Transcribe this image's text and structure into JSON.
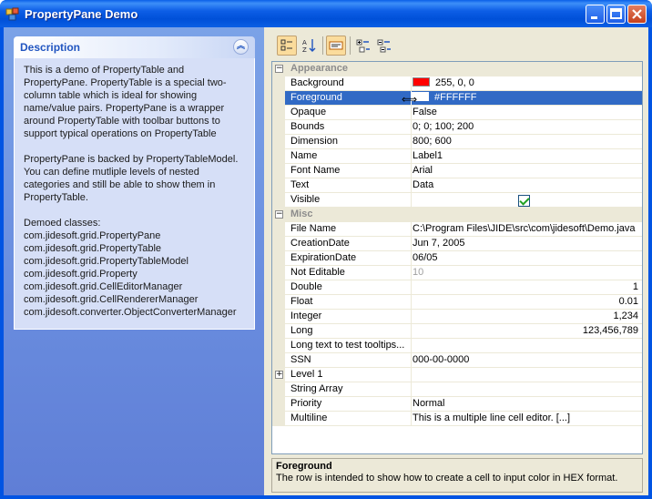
{
  "window": {
    "title": "PropertyPane Demo"
  },
  "description": {
    "title": "Description",
    "paragraphs": [
      "This is a demo of PropertyTable and PropertyPane. PropertyTable is a special two-column table which is ideal for showing name/value pairs. PropertyPane is a wrapper around PropertyTable with toolbar buttons to support typical operations on PropertyTable",
      "PropertyPane is backed by PropertyTableModel. You can define mutliple levels of nested categories and still be able to show them in PropertyTable.",
      "Demoed classes:"
    ],
    "classes": [
      "com.jidesoft.grid.PropertyPane",
      "com.jidesoft.grid.PropertyTable",
      "com.jidesoft.grid.PropertyTableModel",
      "com.jidesoft.grid.Property",
      "com.jidesoft.grid.CellEditorManager",
      "com.jidesoft.grid.CellRendererManager",
      "com.jidesoft.converter.ObjectConverterManager"
    ]
  },
  "toolbar": {
    "categorized": "categorized-view-icon",
    "sorted": "sort-az-icon",
    "description": "show-description-icon",
    "expand": "expand-all-icon",
    "collapse": "collapse-all-icon"
  },
  "grid": {
    "categories": {
      "appearance": "Appearance",
      "misc": "Misc"
    },
    "appearance": [
      {
        "name": "Background",
        "value": "255, 0, 0",
        "swatch": "#ff0000"
      },
      {
        "name": "Foreground",
        "value": "#FFFFFF",
        "swatch": "#ffffff"
      },
      {
        "name": "Opaque",
        "value": "False"
      },
      {
        "name": "Bounds",
        "value": "0; 0; 100; 200"
      },
      {
        "name": "Dimension",
        "value": "800; 600"
      },
      {
        "name": "Name",
        "value": "Label1"
      },
      {
        "name": "Font Name",
        "value": "Arial"
      },
      {
        "name": "Text",
        "value": "Data"
      },
      {
        "name": "Visible",
        "value": ""
      }
    ],
    "misc": [
      {
        "name": "File Name",
        "value": "C:\\Program Files\\JIDE\\src\\com\\jidesoft\\Demo.java"
      },
      {
        "name": "CreationDate",
        "value": "Jun 7, 2005"
      },
      {
        "name": "ExpirationDate",
        "value": "06/05"
      },
      {
        "name": "Not Editable",
        "value": "10"
      },
      {
        "name": "Double",
        "value": "1"
      },
      {
        "name": "Float",
        "value": "0.01"
      },
      {
        "name": "Integer",
        "value": "1,234"
      },
      {
        "name": "Long",
        "value": "123,456,789"
      },
      {
        "name": "Long text to test tooltips...",
        "value": ""
      },
      {
        "name": "SSN",
        "value": "000-00-0000"
      },
      {
        "name": "Level 1",
        "value": ""
      },
      {
        "name": "String Array",
        "value": ""
      },
      {
        "name": "Priority",
        "value": "Normal"
      },
      {
        "name": "Multiline",
        "value": "This is a multiple line cell editor.  [...]"
      }
    ]
  },
  "help": {
    "title": "Foreground",
    "text": "The row is intended to show how to create a cell to input color in HEX format."
  },
  "colors": {
    "selection": "#316ac5",
    "titlebar": "#0054e3",
    "accent": "#2155c0"
  }
}
